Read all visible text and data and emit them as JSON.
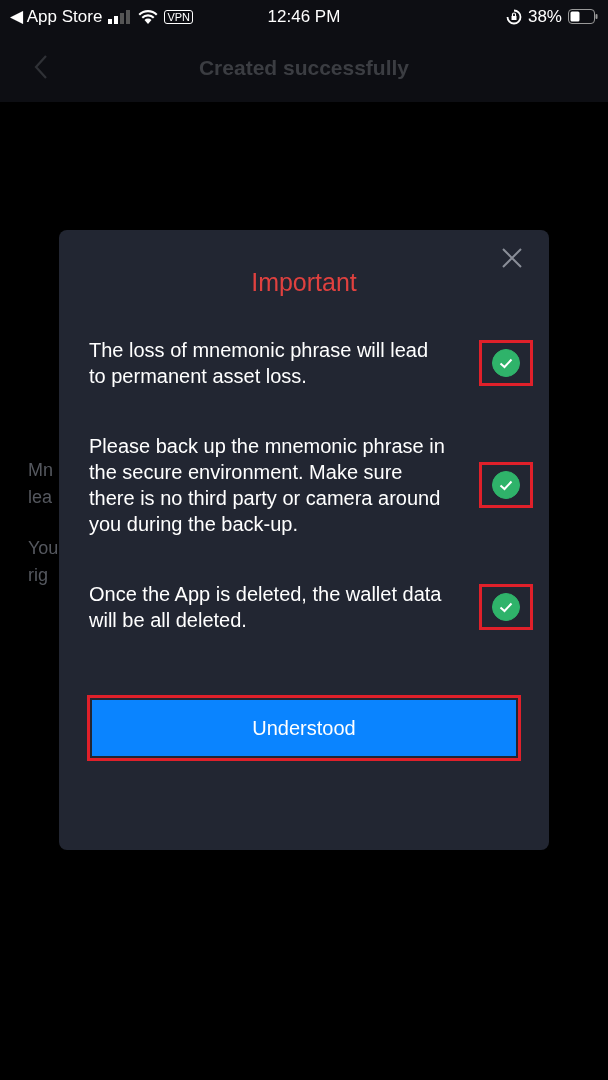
{
  "status_bar": {
    "back_label": "◀ App Store",
    "vpn": "VPN",
    "time": "12:46 PM",
    "battery": "38%"
  },
  "nav": {
    "title": "Created successfully"
  },
  "background_text": [
    "Mn",
    "lea",
    "You",
    "rig"
  ],
  "dialog": {
    "title": "Important",
    "items": [
      {
        "text": "The loss of mnemonic phrase will lead to permanent asset loss.",
        "checked": true,
        "highlighted": true
      },
      {
        "text": "Please back up the mnemonic phrase in the secure environment. Make sure there is no third party or camera around you during the back-up.",
        "checked": true,
        "highlighted": true
      },
      {
        "text": "Once the App is deleted, the wallet data will be all deleted.",
        "checked": true,
        "highlighted": true
      }
    ],
    "button": {
      "label": "Understood",
      "highlighted": true
    }
  }
}
